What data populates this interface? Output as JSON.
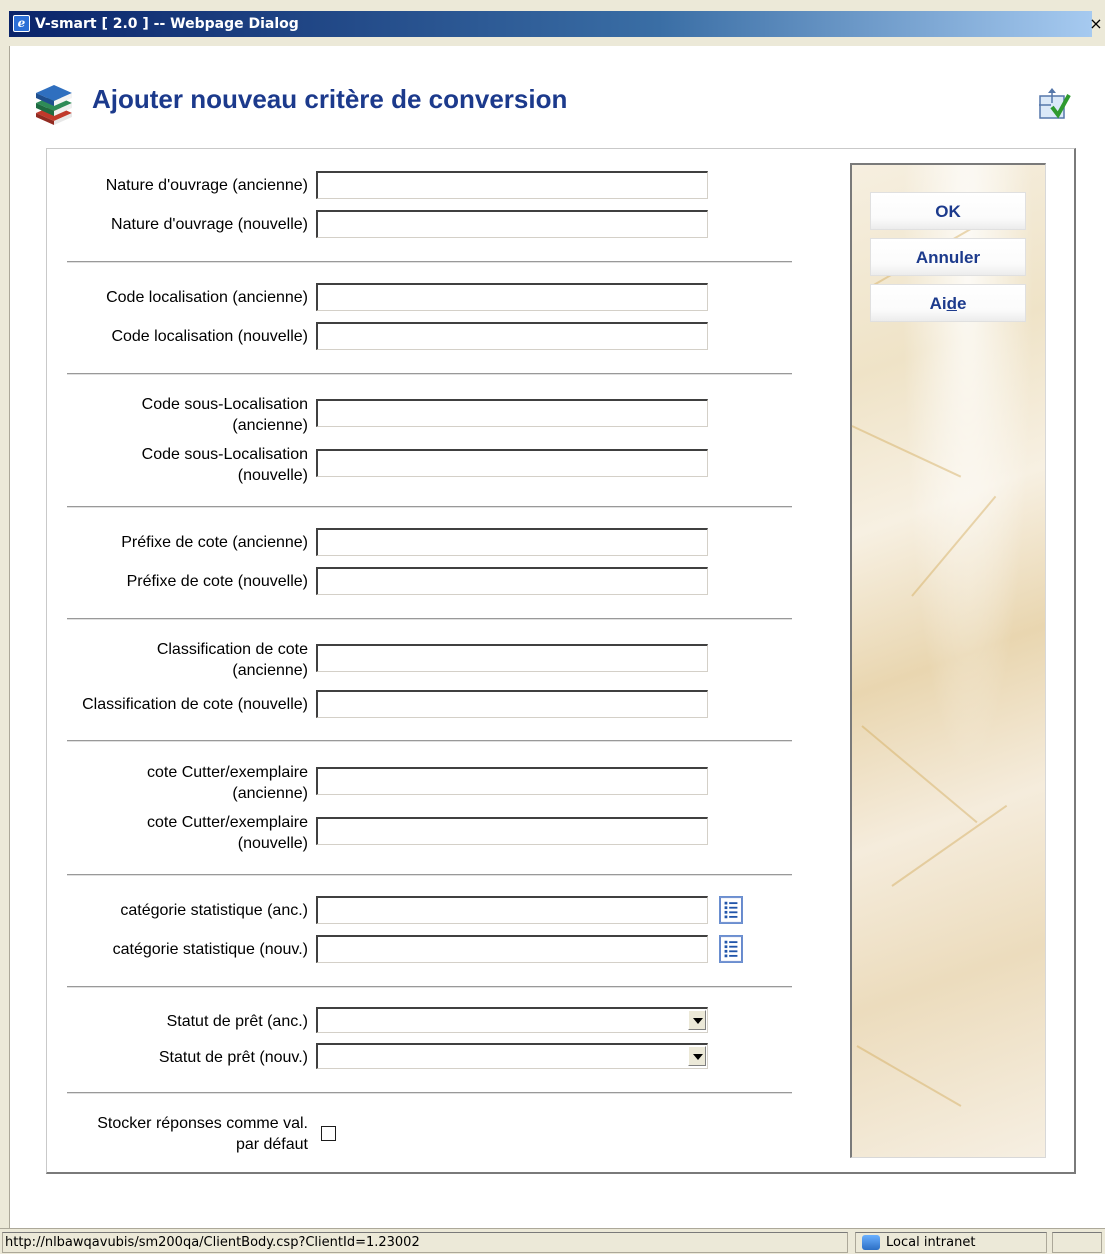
{
  "window": {
    "title": "V-smart [ 2.0 ] -- Webpage Dialog",
    "close_glyph": "×"
  },
  "header": {
    "title": "Ajouter nouveau critère de conversion",
    "logo_icon": "books-icon",
    "settings_icon": "settings-check-icon"
  },
  "form": {
    "nature_old_label": "Nature d'ouvrage (ancienne)",
    "nature_new_label": "Nature d'ouvrage (nouvelle)",
    "loc_old_label": "Code localisation (ancienne)",
    "loc_new_label": "Code localisation (nouvelle)",
    "subloc_old_label_1": "Code sous-Localisation",
    "subloc_old_label_2": "(ancienne)",
    "subloc_new_label_1": "Code sous-Localisation",
    "subloc_new_label_2": "(nouvelle)",
    "prefix_old_label": "Préfixe de cote (ancienne)",
    "prefix_new_label": "Préfixe de cote (nouvelle)",
    "class_old_label_1": "Classification de cote",
    "class_old_label_2": "(ancienne)",
    "class_new_label": "Classification de cote (nouvelle)",
    "cutter_old_label_1": "cote Cutter/exemplaire",
    "cutter_old_label_2": "(ancienne)",
    "cutter_new_label_1": "cote Cutter/exemplaire",
    "cutter_new_label_2": "(nouvelle)",
    "stat_old_label": "catégorie statistique (anc.)",
    "stat_new_label": "catégorie statistique (nouv.)",
    "loan_old_label": "Statut de prêt (anc.)",
    "loan_new_label": "Statut de prêt (nouv.)",
    "store_label_1": "Stocker réponses comme val.",
    "store_label_2": "par défaut",
    "store_checked": false
  },
  "buttons": {
    "ok": "OK",
    "cancel": "Annuler",
    "help_pre": "Ai",
    "help_accel": "d",
    "help_post": "e"
  },
  "statusbar": {
    "url": "http://nlbawqavubis/sm200qa/ClientBody.csp?ClientId=1.23002",
    "zone": "Local intranet"
  }
}
